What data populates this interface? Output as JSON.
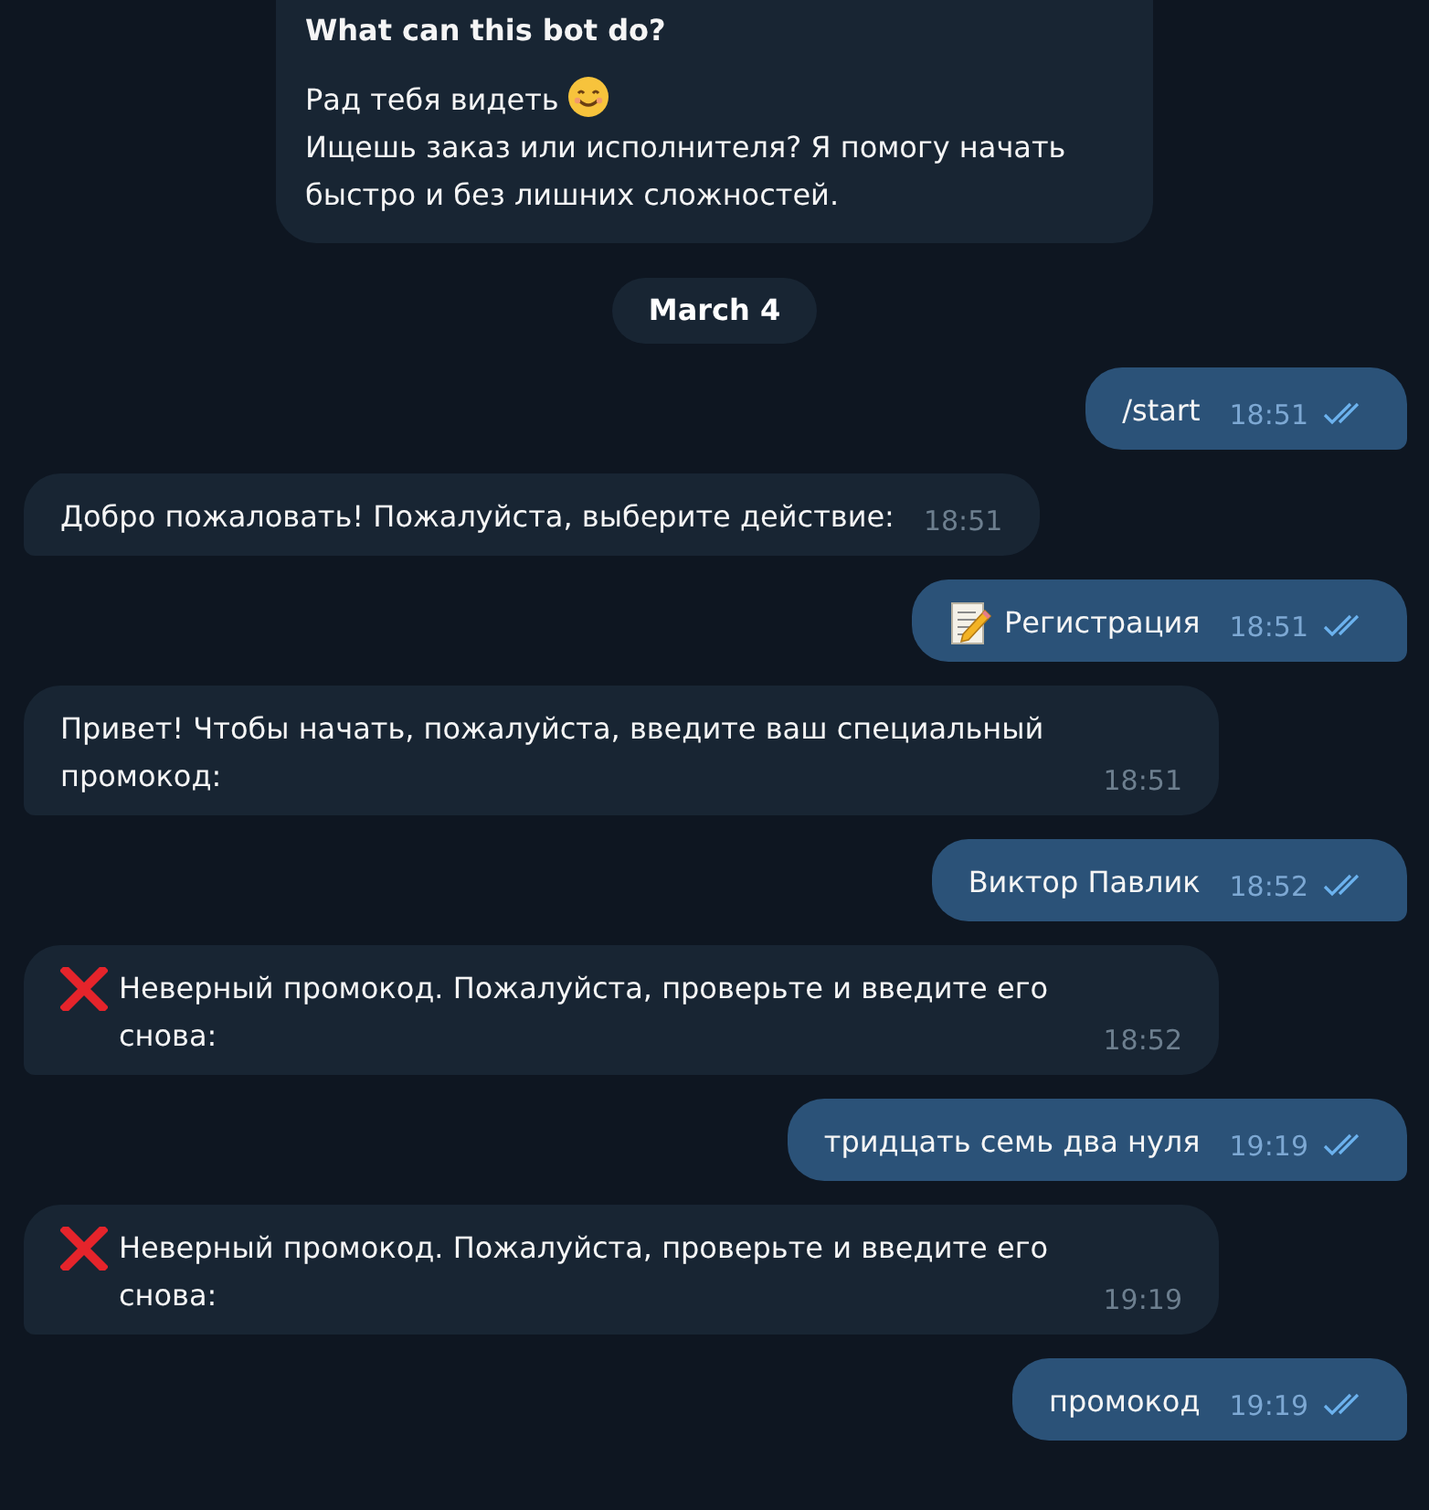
{
  "bot_info": {
    "title": "What can this bot do?",
    "greeting": "Рад тебя видеть",
    "text": "Ищешь заказ или исполнителя? Я помогу начать быстро и без лишних сложностей."
  },
  "date": "March 4",
  "messages": [
    {
      "outgoing": true,
      "kind": "plain",
      "text": "/start",
      "time": "18:51",
      "read": true
    },
    {
      "outgoing": false,
      "kind": "plain",
      "text": "Добро пожаловать! Пожалуйста, выберите действие:",
      "time": "18:51"
    },
    {
      "outgoing": true,
      "kind": "form",
      "text": "Регистрация",
      "time": "18:51",
      "read": true
    },
    {
      "outgoing": false,
      "kind": "plain",
      "text": "Привет! Чтобы начать, пожалуйста, введите ваш специальный промокод:",
      "time": "18:51"
    },
    {
      "outgoing": true,
      "kind": "plain",
      "text": "Виктор Павлик",
      "time": "18:52",
      "read": true
    },
    {
      "outgoing": false,
      "kind": "error",
      "text": "Неверный промокод. Пожалуйста, проверьте и введите его снова:",
      "time": "18:52"
    },
    {
      "outgoing": true,
      "kind": "plain",
      "text": "тридцать семь два нуля",
      "time": "19:19",
      "read": true
    },
    {
      "outgoing": false,
      "kind": "error",
      "text": "Неверный промокод. Пожалуйста, проверьте и введите его снова:",
      "time": "19:19"
    },
    {
      "outgoing": true,
      "kind": "plain",
      "text": "промокод",
      "time": "19:19",
      "read": true
    }
  ]
}
